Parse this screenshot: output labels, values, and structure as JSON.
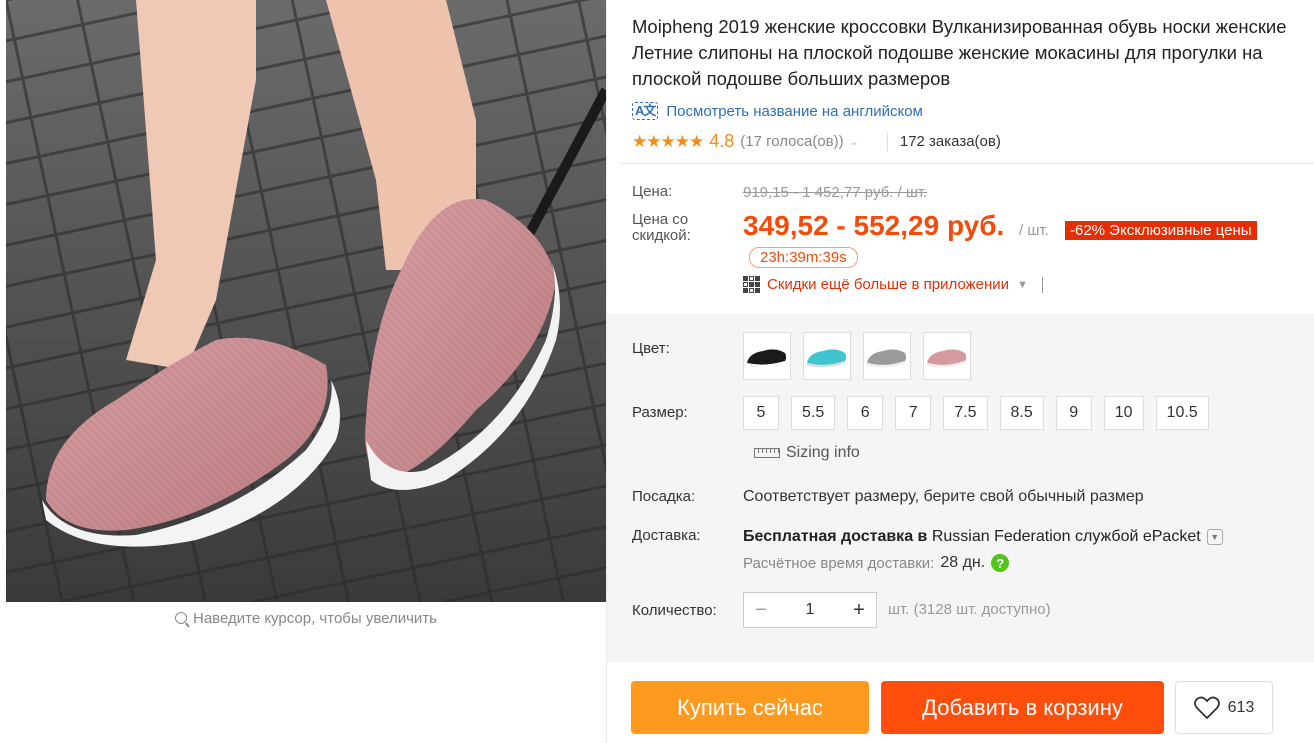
{
  "product": {
    "title": "Moipheng 2019 женские кроссовки Вулканизированная обувь носки женские Летние слипоны на плоской подошве женские мокасины для прогулки на плоской подошве больших размеров",
    "translate_link": "Посмотреть название на английском",
    "rating": "4.8",
    "votes": "(17 голоса(ов))",
    "orders": "172 заказа(ов)",
    "stars_filled": 5
  },
  "gallery": {
    "zoom_hint": "Наведите курсор, чтобы увеличить"
  },
  "price": {
    "label": "Цена:",
    "original": "919,15 - 1 452,77 руб. / шт.",
    "sale_label": "Цена со скидкой:",
    "sale": "349,52 - 552,29 руб.",
    "per_unit": "/ шт.",
    "badge": "-62% Эксклюзивные цены",
    "timer": "23h:39m:39s",
    "app_promo": "Скидки ещё больше в приложении"
  },
  "sku": {
    "color_label": "Цвет:",
    "colors": [
      {
        "name": "black",
        "hex": "#1a1a1a"
      },
      {
        "name": "cyan",
        "hex": "#3fc4d0"
      },
      {
        "name": "gray",
        "hex": "#9a9a9a"
      },
      {
        "name": "pink",
        "hex": "#d59a9e"
      }
    ],
    "size_label": "Размер:",
    "sizes": [
      "5",
      "5.5",
      "6",
      "7",
      "7.5",
      "8.5",
      "9",
      "10",
      "10.5"
    ],
    "sizing_info": "Sizing info",
    "fit_label": "Посадка:",
    "fit_text": "Соответствует размеру, берите свой обычный размер",
    "shipping_label": "Доставка:",
    "shipping_bold": "Бесплатная доставка в",
    "shipping_rest": " Russian Federation службой ePacket",
    "eta_label": "Расчётное время доставки:",
    "eta_days": "28 дн.",
    "qty_label": "Количество:",
    "qty_minus": "−",
    "qty_value": "1",
    "qty_plus": "+",
    "qty_note": "шт. (3128 шт. доступно)"
  },
  "actions": {
    "buy_now": "Купить сейчас",
    "add_to_cart": "Добавить в корзину",
    "wishlist_count": "613"
  },
  "colors": {
    "accent_orange": "#f24b0b",
    "buy_now_bg": "#ff9a1f",
    "cart_bg": "#ff4e0c",
    "star": "#f38c1b",
    "link": "#2f6fb5"
  }
}
